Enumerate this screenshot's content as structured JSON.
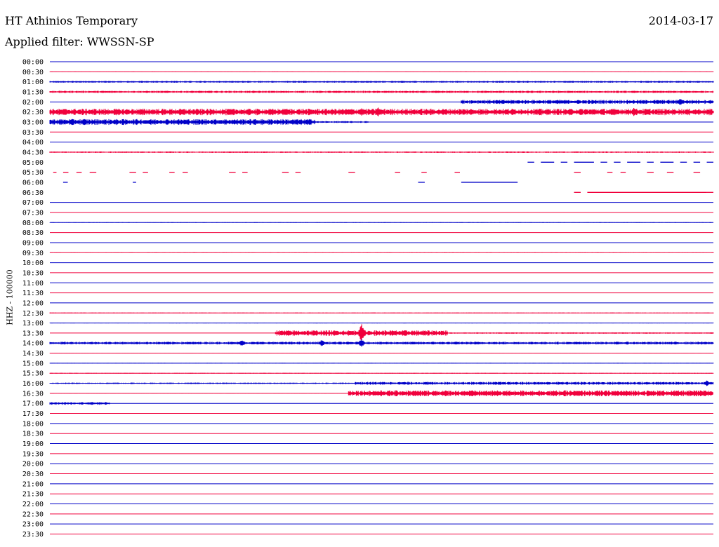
{
  "header": {
    "station": "HT Athinios Temporary",
    "date": "2014-03-17",
    "filter": "Applied filter: WWSSN-SP",
    "channel_label": "HHZ - 100000"
  },
  "colors": {
    "even_row": "#0000c8",
    "odd_row": "#f0003c",
    "background": "#ffffff"
  },
  "chart_data": {
    "type": "line",
    "title": "HT Athinios Temporary",
    "ylabel": "HHZ - 100000",
    "row_labels": [
      "00:00",
      "00:30",
      "01:00",
      "01:30",
      "02:00",
      "02:30",
      "03:00",
      "03:30",
      "04:00",
      "04:30",
      "05:00",
      "05:30",
      "06:00",
      "06:30",
      "07:00",
      "07:30",
      "08:00",
      "08:30",
      "09:00",
      "09:30",
      "10:00",
      "10:30",
      "11:00",
      "11:30",
      "12:00",
      "12:30",
      "13:00",
      "13:30",
      "14:00",
      "14:30",
      "15:00",
      "15:30",
      "16:00",
      "16:30",
      "17:00",
      "17:30",
      "18:00",
      "18:30",
      "19:00",
      "19:30",
      "20:00",
      "20:30",
      "21:00",
      "21:30",
      "22:00",
      "22:30",
      "23:00",
      "23:30"
    ],
    "minutes_per_row": 30,
    "noise_segments": [
      {
        "row": 1,
        "from": 0.0,
        "to": 1.0,
        "amp": 0.3
      },
      {
        "row": 2,
        "from": 0.0,
        "to": 1.0,
        "amp": 1.0
      },
      {
        "row": 3,
        "from": 0.0,
        "to": 1.0,
        "amp": 1.2
      },
      {
        "row": 4,
        "from": 0.62,
        "to": 1.0,
        "amp": 2.2
      },
      {
        "row": 5,
        "from": 0.0,
        "to": 1.0,
        "amp": 3.5
      },
      {
        "row": 6,
        "from": 0.0,
        "to": 0.4,
        "amp": 3.2
      },
      {
        "row": 6,
        "from": 0.4,
        "to": 0.48,
        "amp": 1.0
      },
      {
        "row": 9,
        "from": 0.0,
        "to": 1.0,
        "amp": 0.8
      },
      {
        "row": 16,
        "from": 0.0,
        "to": 1.0,
        "amp": 0.3
      },
      {
        "row": 19,
        "from": 0.0,
        "to": 1.0,
        "amp": 0.3
      },
      {
        "row": 25,
        "from": 0.0,
        "to": 1.0,
        "amp": 0.5
      },
      {
        "row": 26,
        "from": 0.0,
        "to": 1.0,
        "amp": 0.4
      },
      {
        "row": 27,
        "from": 0.34,
        "to": 0.6,
        "amp": 3.0
      },
      {
        "row": 27,
        "from": 0.6,
        "to": 1.0,
        "amp": 0.8
      },
      {
        "row": 28,
        "from": 0.0,
        "to": 1.0,
        "amp": 1.5
      },
      {
        "row": 29,
        "from": 0.0,
        "to": 1.0,
        "amp": 0.3
      },
      {
        "row": 30,
        "from": 0.0,
        "to": 1.0,
        "amp": 0.4
      },
      {
        "row": 31,
        "from": 0.0,
        "to": 1.0,
        "amp": 0.5
      },
      {
        "row": 32,
        "from": 0.0,
        "to": 0.46,
        "amp": 0.8
      },
      {
        "row": 32,
        "from": 0.46,
        "to": 1.0,
        "amp": 1.6
      },
      {
        "row": 33,
        "from": 0.0,
        "to": 0.45,
        "amp": 0.3
      },
      {
        "row": 33,
        "from": 0.45,
        "to": 1.0,
        "amp": 3.2
      },
      {
        "row": 34,
        "from": 0.0,
        "to": 0.09,
        "amp": 1.5
      }
    ],
    "events": [
      {
        "row": 5,
        "at": 0.355,
        "amp": 6
      },
      {
        "row": 5,
        "at": 0.47,
        "amp": 6
      },
      {
        "row": 5,
        "at": 0.495,
        "amp": 7
      },
      {
        "row": 5,
        "at": 0.88,
        "amp": 6
      },
      {
        "row": 4,
        "at": 0.95,
        "amp": 5
      },
      {
        "row": 6,
        "at": 0.052,
        "amp": 5
      },
      {
        "row": 27,
        "at": 0.47,
        "amp": 13
      },
      {
        "row": 28,
        "at": 0.29,
        "amp": 5
      },
      {
        "row": 28,
        "at": 0.41,
        "amp": 5
      },
      {
        "row": 28,
        "at": 0.47,
        "amp": 6
      },
      {
        "row": 32,
        "at": 0.99,
        "amp": 4
      }
    ],
    "gap_rows": [
      {
        "row": 10,
        "from": 0.0,
        "to": 0.72,
        "dashed_after": 0.72
      },
      {
        "row": 11,
        "from": 0.0,
        "to": 1.0,
        "dashed_after": 0.0
      },
      {
        "row": 12,
        "from": 0.0,
        "to": 1.0,
        "dashed_after": 1.0
      },
      {
        "row": 13,
        "from": 0.0,
        "to": 1.0,
        "dashed_after": 1.0
      }
    ],
    "row_fragments": [
      {
        "row": 11,
        "segments": [
          [
            0.005,
            0.01
          ],
          [
            0.02,
            0.028
          ],
          [
            0.04,
            0.048
          ],
          [
            0.06,
            0.07
          ],
          [
            0.12,
            0.13
          ],
          [
            0.14,
            0.148
          ],
          [
            0.18,
            0.188
          ],
          [
            0.2,
            0.208
          ],
          [
            0.27,
            0.28
          ],
          [
            0.29,
            0.298
          ],
          [
            0.35,
            0.36
          ],
          [
            0.37,
            0.378
          ],
          [
            0.45,
            0.46
          ],
          [
            0.52,
            0.528
          ],
          [
            0.56,
            0.568
          ],
          [
            0.61,
            0.618
          ],
          [
            0.79,
            0.8
          ],
          [
            0.84,
            0.848
          ],
          [
            0.86,
            0.868
          ],
          [
            0.9,
            0.91
          ],
          [
            0.93,
            0.94
          ],
          [
            0.97,
            0.98
          ]
        ]
      },
      {
        "row": 12,
        "segments": [
          [
            0.02,
            0.027
          ],
          [
            0.125,
            0.13
          ],
          [
            0.555,
            0.565
          ],
          [
            0.62,
            0.705
          ]
        ]
      },
      {
        "row": 13,
        "segments": [
          [
            0.79,
            0.8
          ],
          [
            0.81,
            0.99
          ],
          [
            0.99,
            1.0
          ]
        ]
      },
      {
        "row": 10,
        "segments": [
          [
            0.72,
            0.73
          ],
          [
            0.74,
            0.76
          ],
          [
            0.77,
            0.78
          ],
          [
            0.79,
            0.82
          ],
          [
            0.83,
            0.84
          ],
          [
            0.85,
            0.86
          ],
          [
            0.87,
            0.89
          ],
          [
            0.9,
            0.91
          ],
          [
            0.92,
            0.94
          ],
          [
            0.95,
            0.96
          ],
          [
            0.97,
            0.98
          ],
          [
            0.99,
            1.0
          ]
        ]
      }
    ]
  }
}
